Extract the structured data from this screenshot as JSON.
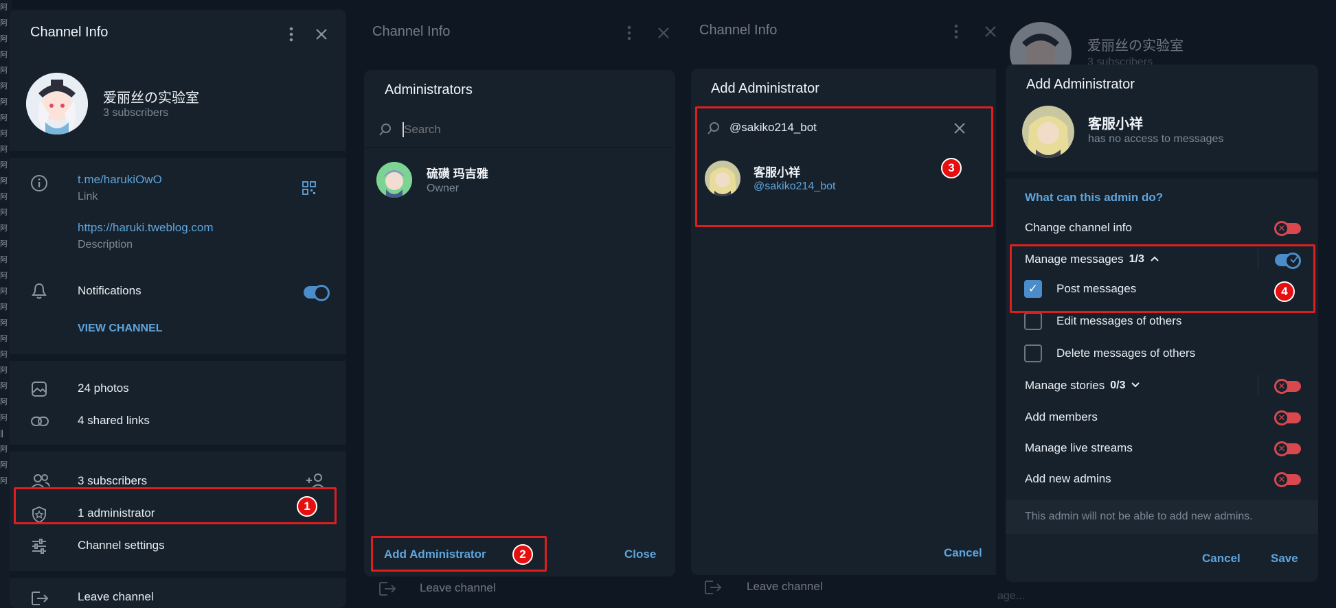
{
  "background_strip": [
    "阿",
    "阿",
    "阿",
    "阿",
    "阿",
    "阿",
    "阿",
    "阿",
    "阿",
    "阿",
    "阿",
    "阿",
    "阿",
    "阿",
    "阿",
    "阿",
    "阿",
    "阿",
    "阿",
    "阿",
    "阿",
    "阿",
    "阿",
    "阿",
    "阿",
    "阿",
    "阿",
    "∥",
    "阿",
    "阿",
    "阿"
  ],
  "panel1": {
    "title": "Channel Info",
    "channel_name": "爱丽丝の实验室",
    "subscribers": "3 subscribers",
    "link": "t.me/harukiOwO",
    "link_label": "Link",
    "description_url": "https://haruki.tweblog.com",
    "description_label": "Description",
    "notifications": "Notifications",
    "view_channel": "VIEW CHANNEL",
    "photos": "24 photos",
    "shared_links": "4 shared links",
    "subscribers_row": "3 subscribers",
    "administrators": "1 administrator",
    "channel_settings": "Channel settings",
    "leave": "Leave channel",
    "badge": "1"
  },
  "panel2": {
    "bg_title": "Channel Info",
    "title": "Administrators",
    "search_placeholder": "Search",
    "owner_name": "硫磺 玛吉雅",
    "owner_role": "Owner",
    "add_admin": "Add Administrator",
    "close": "Close",
    "leave": "Leave channel",
    "badge": "2"
  },
  "panel3": {
    "bg_title": "Channel Info",
    "title": "Add Administrator",
    "search_value": "@sakiko214_bot",
    "result_name": "客服小祥",
    "result_handle": "@sakiko214_bot",
    "cancel": "Cancel",
    "leave": "Leave channel",
    "badge": "3"
  },
  "panel4": {
    "bg_channel_name": "爱丽丝の实验室",
    "bg_subscribers": "3 subscribers",
    "bg_footer": "age...",
    "title": "Add Administrator",
    "bot_name": "客服小祥",
    "bot_status": "has no access to messages",
    "section_title": "What can this admin do?",
    "change_info": "Change channel info",
    "manage_messages": "Manage messages",
    "manage_messages_count": "1/3",
    "post_messages": "Post messages",
    "edit_messages": "Edit messages of others",
    "delete_messages": "Delete messages of others",
    "manage_stories": "Manage stories",
    "manage_stories_count": "0/3",
    "add_members": "Add members",
    "manage_live": "Manage live streams",
    "add_admins": "Add new admins",
    "note": "This admin will not be able to add new admins.",
    "cancel": "Cancel",
    "save": "Save",
    "badge": "4"
  },
  "colors": {
    "accent": "#5ea5dd",
    "highlight": "#e01e1e",
    "toggle_on": "#4b8ccb",
    "toggle_off": "#d9474f",
    "panel": "#17212b"
  }
}
